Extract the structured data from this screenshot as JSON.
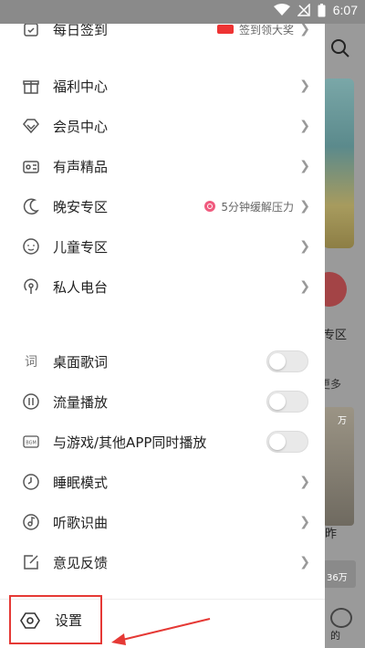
{
  "status_bar": {
    "time": "6:07"
  },
  "menu": {
    "top_partial": {
      "label": "每日签到",
      "extra": "签到领大奖"
    },
    "items": [
      {
        "label": "福利中心"
      },
      {
        "label": "会员中心"
      },
      {
        "label": "有声精品"
      },
      {
        "label": "晚安专区",
        "extra": "5分钟缓解压力"
      },
      {
        "label": "儿童专区"
      },
      {
        "label": "私人电台"
      }
    ],
    "toggles": [
      {
        "label": "桌面歌词",
        "on": false
      },
      {
        "label": "流量播放",
        "on": false
      },
      {
        "label": "与游戏/其他APP同时播放",
        "on": false
      }
    ],
    "more_items": [
      {
        "label": "睡眠模式"
      },
      {
        "label": "听歌识曲"
      },
      {
        "label": "意见反馈"
      }
    ],
    "settings_label": "设置"
  },
  "background_app": {
    "category_label": "专区",
    "more_label": "更多",
    "play_count": "万",
    "card_caption": "昨",
    "play_count_2": "36万",
    "tab_label": "的"
  },
  "colors": {
    "highlight_border": "#e53935",
    "accent_pink": "#f05a7e"
  }
}
